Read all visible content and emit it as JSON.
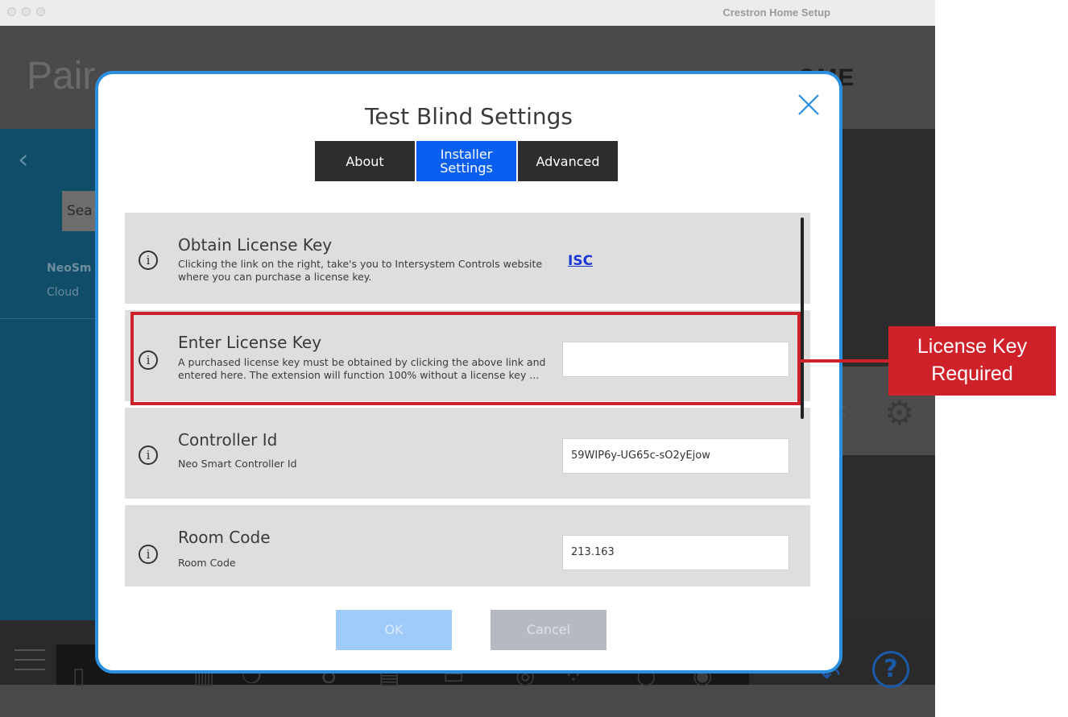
{
  "window": {
    "title": "Crestron Home Setup"
  },
  "background": {
    "page_title_partial": "Pair",
    "brand_partial": "OME",
    "search_stub": "Sea",
    "side_item_name": "NeoSm",
    "side_item_sub": "Cloud"
  },
  "modal": {
    "title": "Test Blind Settings",
    "tabs": [
      {
        "label": "About"
      },
      {
        "label": "Installer Settings"
      },
      {
        "label": "Advanced"
      }
    ],
    "rows": [
      {
        "title": "Obtain License Key",
        "description": "Clicking the link on the right, take's you to Intersystem Controls website where you can purchase a license key.",
        "link": "ISC"
      },
      {
        "title": "Enter License Key",
        "description": "A purchased license key must be obtained by clicking the above link and entered here. The extension will function 100% without a license key ...",
        "value": ""
      },
      {
        "title": "Controller Id",
        "description": "Neo Smart Controller Id",
        "value": "59WIP6y-UG65c-sO2yEjow"
      },
      {
        "title": "Room Code",
        "description": "Room Code",
        "value": "213.163"
      }
    ],
    "ok_label": "OK",
    "cancel_label": "Cancel"
  },
  "annotation": {
    "line1": "License Key",
    "line2": "Required",
    "color": "#cf2129"
  },
  "colors": {
    "accent": "#2b8fe0",
    "active_tab": "#0a5ff0"
  }
}
